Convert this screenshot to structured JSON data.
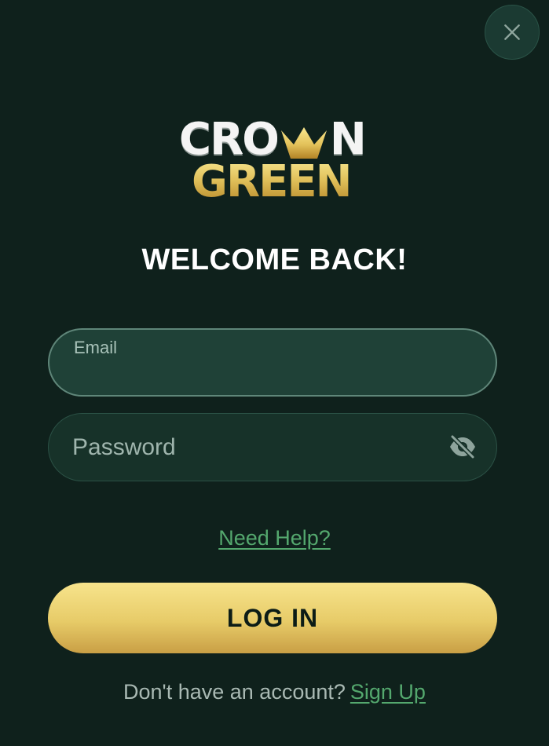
{
  "brand": {
    "line1_left": "CRO",
    "line1_right": "N",
    "line2": "GREEN",
    "colors": {
      "background": "#0f211c",
      "accent_green": "#54a86e",
      "gold": "#e0c05a"
    }
  },
  "close_button": {
    "icon": "close-icon"
  },
  "heading": {
    "title": "WELCOME BACK!"
  },
  "form": {
    "email": {
      "label": "Email",
      "value": ""
    },
    "password": {
      "placeholder": "Password",
      "value": "",
      "visibility_icon": "eye-slash-icon"
    }
  },
  "links": {
    "help": "Need Help?"
  },
  "buttons": {
    "login": "LOG IN"
  },
  "footer": {
    "prompt": "Don't have an account?",
    "signup": "Sign Up"
  }
}
